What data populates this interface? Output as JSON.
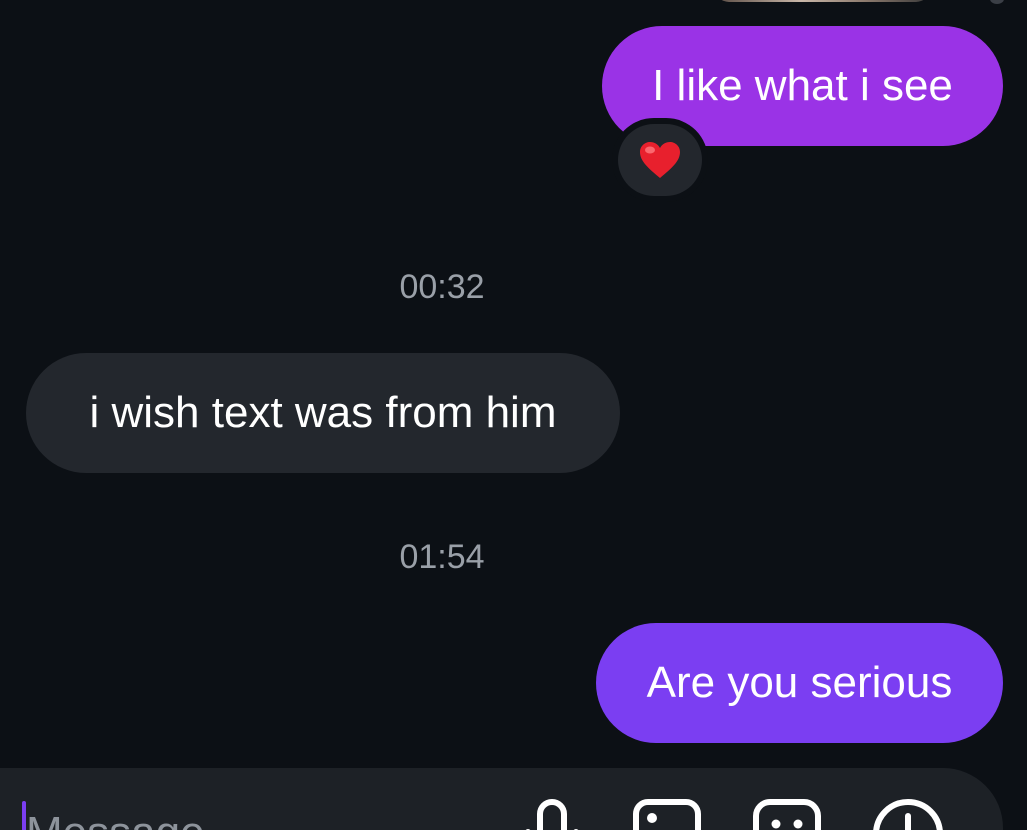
{
  "messages": [
    {
      "id": "m1",
      "direction": "outgoing",
      "text": "I like what i see",
      "reaction": "❤️"
    },
    {
      "id": "m2",
      "direction": "incoming",
      "text": "i wish text was from him"
    },
    {
      "id": "m3",
      "direction": "outgoing",
      "text": "Are you serious"
    }
  ],
  "timestamps": [
    "00:32",
    "01:54"
  ],
  "composer": {
    "placeholder": "Message",
    "icons": [
      "microphone-icon",
      "image-icon",
      "sticker-icon",
      "add-circle-icon"
    ]
  },
  "colors": {
    "background": "#0c1015",
    "outgoing_bubble_1": "#9a33e6",
    "outgoing_bubble_2": "#7b3ef2",
    "incoming_bubble": "#23272d",
    "timestamp": "#9aa0a8",
    "composer": "#1d2126"
  }
}
